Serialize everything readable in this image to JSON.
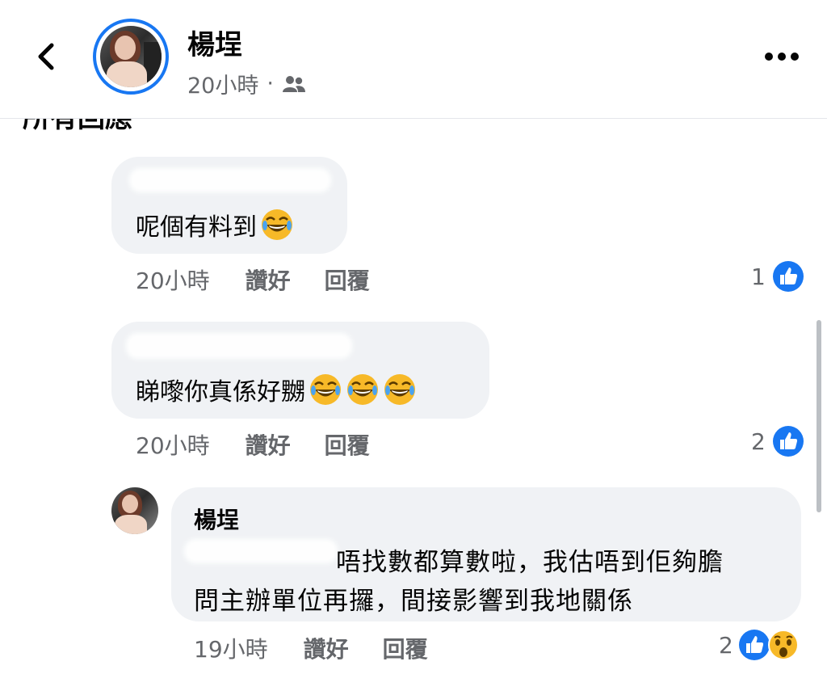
{
  "header": {
    "poster_name": "楊埕",
    "time": "20小時",
    "separator": "·",
    "audience_icon": "friends-icon",
    "back_icon": "chevron-left-icon",
    "more_icon": "more-horizontal-icon"
  },
  "section_title": "所有回應",
  "comments": [
    {
      "text": "呢個有料到",
      "emoji_count": 1,
      "time": "20小時",
      "like_label": "讚好",
      "reply_label": "回覆",
      "reaction_count": "1"
    },
    {
      "text": "睇嚟你真係好嬲",
      "emoji_count": 3,
      "time": "20小時",
      "like_label": "讚好",
      "reply_label": "回覆",
      "reaction_count": "2"
    }
  ],
  "reply": {
    "author": "楊埕",
    "line1": "唔找數都算數啦，我估唔到佢夠膽",
    "line2": "問主辦單位再攞，間接影響到我地關係",
    "time": "19小時",
    "like_label": "讚好",
    "reply_label": "回覆",
    "reaction_count": "2"
  },
  "colors": {
    "accent": "#1877f2",
    "bubble": "#f0f2f5",
    "secondary_text": "#65676b"
  }
}
